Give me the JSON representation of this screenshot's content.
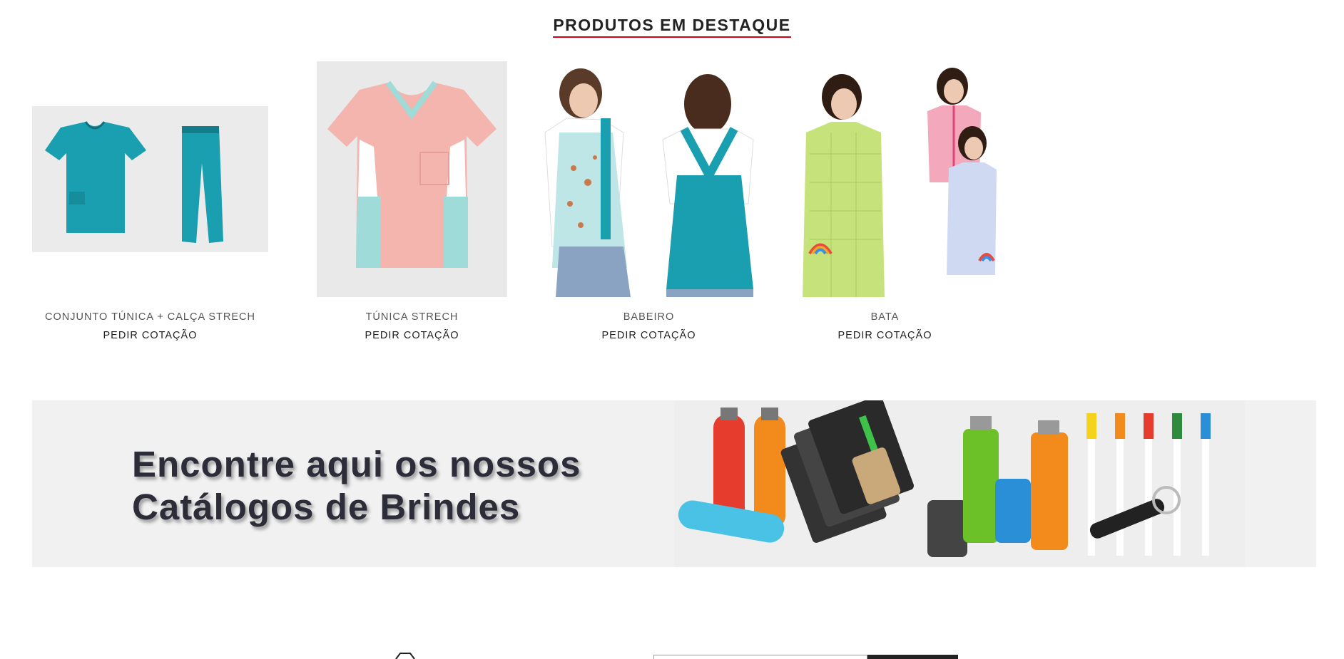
{
  "section": {
    "title": "PRODUTOS EM DESTAQUE"
  },
  "products": [
    {
      "name": "CONJUNTO TÚNICA + CALÇA STRECH",
      "cta": "PEDIR COTAÇÃO"
    },
    {
      "name": "TÚNICA STRECH",
      "cta": "PEDIR COTAÇÃO"
    },
    {
      "name": "BABEIRO",
      "cta": "PEDIR COTAÇÃO"
    },
    {
      "name": "BATA",
      "cta": "PEDIR COTAÇÃO"
    }
  ],
  "banner": {
    "line1": "Encontre aqui os nossos",
    "line2": "Catálogos de Brindes"
  },
  "colors": {
    "accent": "#d0021b",
    "teal": "#1a9fb0"
  }
}
